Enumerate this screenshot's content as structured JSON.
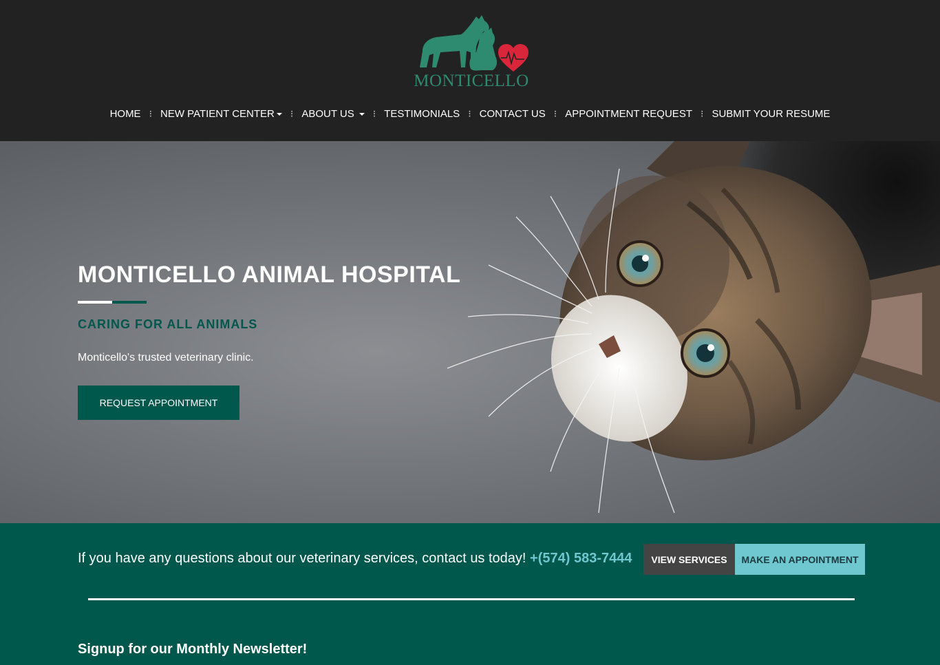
{
  "brand": {
    "logo_text": "MONTICELLO",
    "logo_color": "#2e8b6f",
    "heart_color": "#d9263a"
  },
  "nav": {
    "items": [
      {
        "label": "HOME",
        "dropdown": false
      },
      {
        "label": "NEW PATIENT CENTER",
        "dropdown": true
      },
      {
        "label": "ABOUT US",
        "dropdown": true
      },
      {
        "label": "TESTIMONIALS",
        "dropdown": false
      },
      {
        "label": "CONTACT US",
        "dropdown": false
      },
      {
        "label": "APPOINTMENT REQUEST",
        "dropdown": false
      },
      {
        "label": "SUBMIT YOUR RESUME",
        "dropdown": false
      }
    ],
    "separator": "⁝"
  },
  "hero": {
    "title": "MONTICELLO ANIMAL HOSPITAL",
    "subtitle": "CARING FOR ALL ANIMALS",
    "description": "Monticello's trusted veterinary clinic.",
    "button_label": "REQUEST APPOINTMENT"
  },
  "cta": {
    "text": "If you have any questions about our veterinary services, contact us today!",
    "phone": "+(574) 583-7444",
    "services_label": "VIEW SERVICES",
    "appointment_label": "MAKE AN APPOINTMENT"
  },
  "newsletter": {
    "heading": "Signup for our Monthly Newsletter!"
  },
  "colors": {
    "header_bg": "#222222",
    "accent_green": "#00574c",
    "accent_cyan": "#6fc7cf",
    "button_dark": "#444444"
  }
}
